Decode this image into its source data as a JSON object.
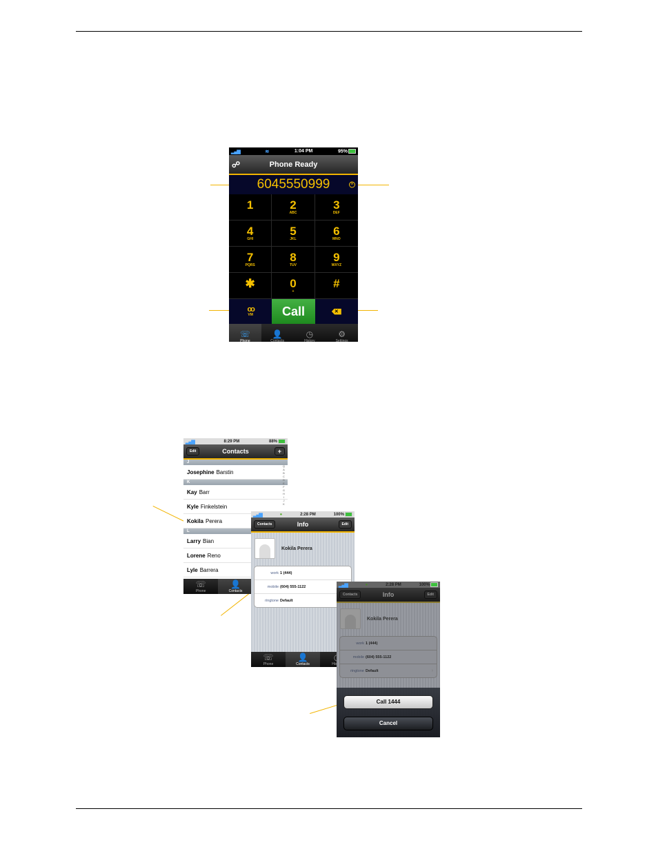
{
  "colors": {
    "accent": "#f2b400",
    "digit": "#f5c000",
    "call_green": "#2f9e2f"
  },
  "dialer": {
    "status": {
      "signal": "▂▄▆",
      "wifi": "wifi-icon",
      "time": "1:04 PM",
      "battery": "95%"
    },
    "title": "Phone Ready",
    "number": "6045550999",
    "keys": [
      {
        "digit": "1",
        "letters": ""
      },
      {
        "digit": "2",
        "letters": "ABC"
      },
      {
        "digit": "3",
        "letters": "DEF"
      },
      {
        "digit": "4",
        "letters": "GHI"
      },
      {
        "digit": "5",
        "letters": "JKL"
      },
      {
        "digit": "6",
        "letters": "MNO"
      },
      {
        "digit": "7",
        "letters": "PQRS"
      },
      {
        "digit": "8",
        "letters": "TUV"
      },
      {
        "digit": "9",
        "letters": "WXYZ"
      },
      {
        "digit": "✱",
        "letters": ""
      },
      {
        "digit": "0",
        "letters": "+"
      },
      {
        "digit": "#",
        "letters": ""
      }
    ],
    "vm_glyph": "oo",
    "vm_label": "VM",
    "call_label": "Call",
    "backspace_glyph": "✕",
    "tabs": [
      {
        "label": "Phone",
        "icon": "☏"
      },
      {
        "label": "Contacts",
        "icon": "👤"
      },
      {
        "label": "History",
        "icon": "◷"
      },
      {
        "label": "Settings",
        "icon": "⚙"
      }
    ]
  },
  "contacts": {
    "status": {
      "signal": "▂▄▆",
      "time": "8:29 PM",
      "battery": "88%"
    },
    "edit_label": "Edit",
    "title": "Contacts",
    "add_label": "+",
    "sections": [
      {
        "letter": "J",
        "rows": [
          {
            "first": "Josephine",
            "last": "Barstin"
          }
        ]
      },
      {
        "letter": "K",
        "rows": [
          {
            "first": "Kay",
            "last": "Barr"
          },
          {
            "first": "Kyle",
            "last": "Finkelstein"
          },
          {
            "first": "Kokila",
            "last": "Perera"
          }
        ]
      },
      {
        "letter": "L",
        "rows": [
          {
            "first": "Larry",
            "last": "Bian"
          },
          {
            "first": "Lorene",
            "last": "Reno"
          },
          {
            "first": "Lyle",
            "last": "Barrera"
          }
        ]
      }
    ],
    "index": [
      "Q",
      "A",
      "B",
      "C",
      "D",
      "E",
      "F",
      "G",
      "H",
      "I",
      "J",
      "K"
    ],
    "tabs": [
      {
        "label": "Phone",
        "icon": "☏"
      },
      {
        "label": "Contacts",
        "icon": "👤"
      },
      {
        "label": "History",
        "icon": "◷"
      }
    ]
  },
  "info": {
    "status": {
      "signal": "▂▄▆",
      "time": "2:28 PM",
      "battery": "100%"
    },
    "back_label": "Contacts",
    "title": "Info",
    "edit_label": "Edit",
    "name": "Kokila Perera",
    "fields": [
      {
        "label": "work",
        "value": "1 (444)"
      },
      {
        "label": "mobile",
        "value": "(604) 555-1122"
      },
      {
        "label": "ringtone",
        "value": "Default"
      }
    ],
    "tabs": [
      {
        "label": "Phone",
        "icon": "☏"
      },
      {
        "label": "Contacts",
        "icon": "👤"
      },
      {
        "label": "History",
        "icon": "◷"
      }
    ]
  },
  "sheet": {
    "status": {
      "signal": "▂▄▆",
      "time": "2:28 PM",
      "battery": "100%"
    },
    "back_label": "Contacts",
    "title": "Info",
    "edit_label": "Edit",
    "name": "Kokila Perera",
    "fields": [
      {
        "label": "work",
        "value": "1 (444)"
      },
      {
        "label": "mobile",
        "value": "(604) 555-1122"
      },
      {
        "label": "ringtone",
        "value": "Default"
      }
    ],
    "chevron": "›",
    "call_label": "Call 1444",
    "cancel_label": "Cancel"
  }
}
